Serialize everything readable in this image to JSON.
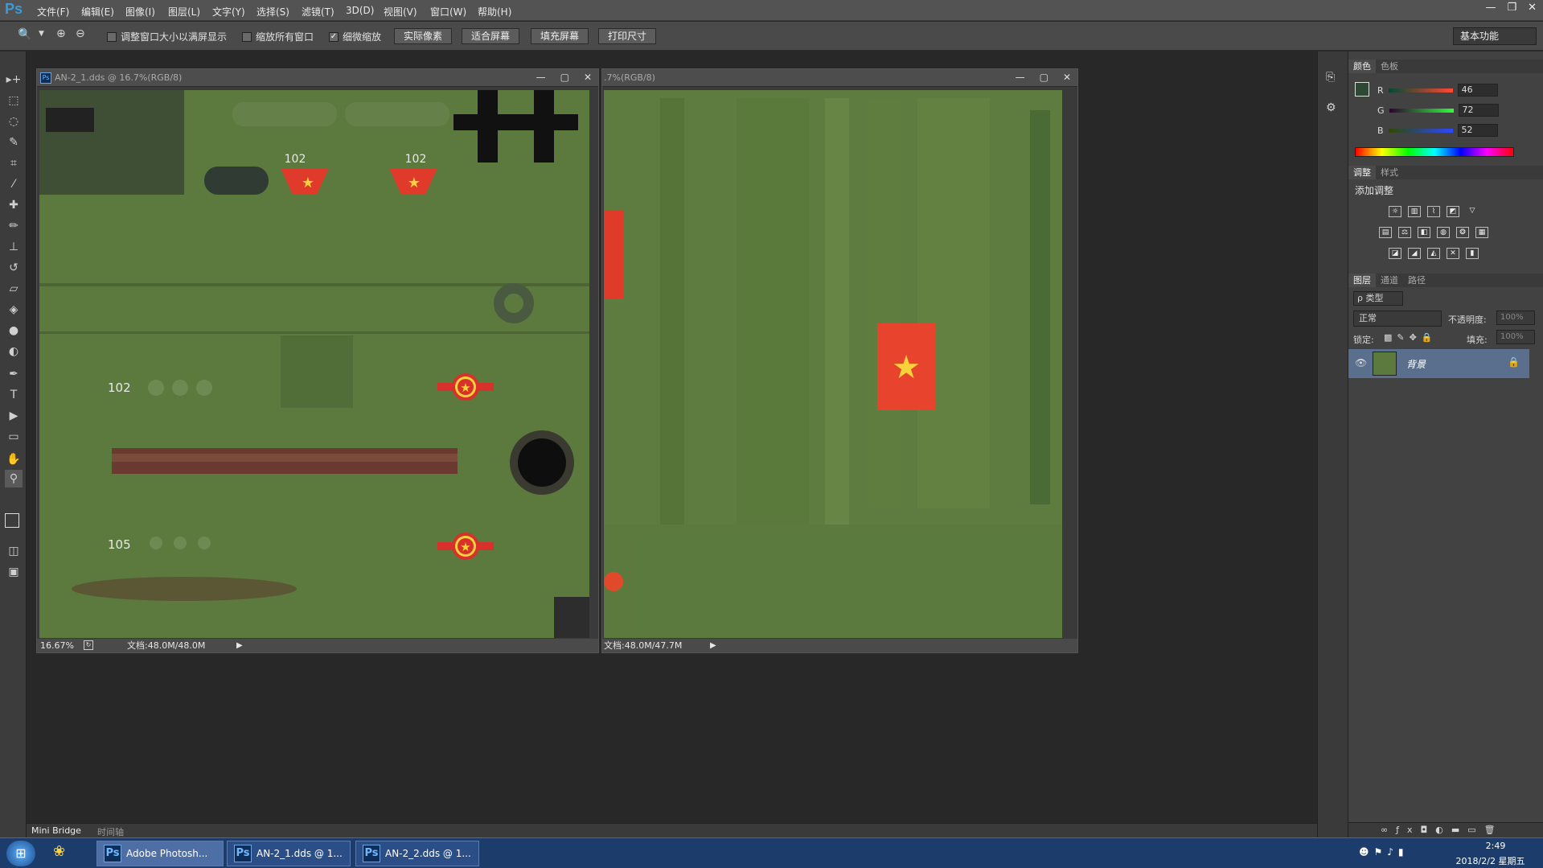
{
  "app": {
    "logo": "Ps",
    "window_controls": [
      "—",
      "❐",
      "✕"
    ]
  },
  "menu": [
    "文件(F)",
    "编辑(E)",
    "图像(I)",
    "图层(L)",
    "文字(Y)",
    "选择(S)",
    "滤镜(T)",
    "3D(D)",
    "视图(V)",
    "窗口(W)",
    "帮助(H)"
  ],
  "options": {
    "zoom_tool": "🔍",
    "checkbox1": "调整窗口大小以满屏显示",
    "checkbox2": "缩放所有窗口",
    "checkbox3": "细微缩放",
    "btn1": "实际像素",
    "btn2": "适合屏幕",
    "btn3": "填充屏幕",
    "btn4": "打印尺寸",
    "workspace": "基本功能"
  },
  "doc1": {
    "title": "AN-2_1.dds @ 16.7%(RGB/8)",
    "zoom": "16.67%",
    "docsize": "文档:48.0M/48.0M",
    "labels": [
      "102",
      "102",
      "102",
      "105"
    ]
  },
  "doc2": {
    "title": ".7%(RGB/8)",
    "docsize": "文档:48.0M/47.7M"
  },
  "color_panel": {
    "tabs": [
      "颜色",
      "色板"
    ],
    "r_label": "R",
    "g_label": "G",
    "b_label": "B",
    "r": "46",
    "g": "72",
    "b": "52",
    "fg_color": "#2e4834"
  },
  "adjust_panel": {
    "tabs": [
      "调整",
      "样式"
    ],
    "title": "添加调整"
  },
  "layers_panel": {
    "tabs": [
      "图层",
      "通道",
      "路径"
    ],
    "filter": "ρ 类型",
    "blend_mode": "正常",
    "opacity_label": "不透明度:",
    "opacity": "100%",
    "lock_label": "锁定:",
    "fill_label": "填充:",
    "fill": "100%",
    "layer_name": "背景"
  },
  "bottom_tabs": [
    "Mini Bridge",
    "时间轴"
  ],
  "taskbar": {
    "items": [
      "Adobe Photosh...",
      "AN-2_1.dds @ 1...",
      "AN-2_2.dds @ 1..."
    ],
    "time": "2:49",
    "date": "2018/2/2 星期五"
  }
}
